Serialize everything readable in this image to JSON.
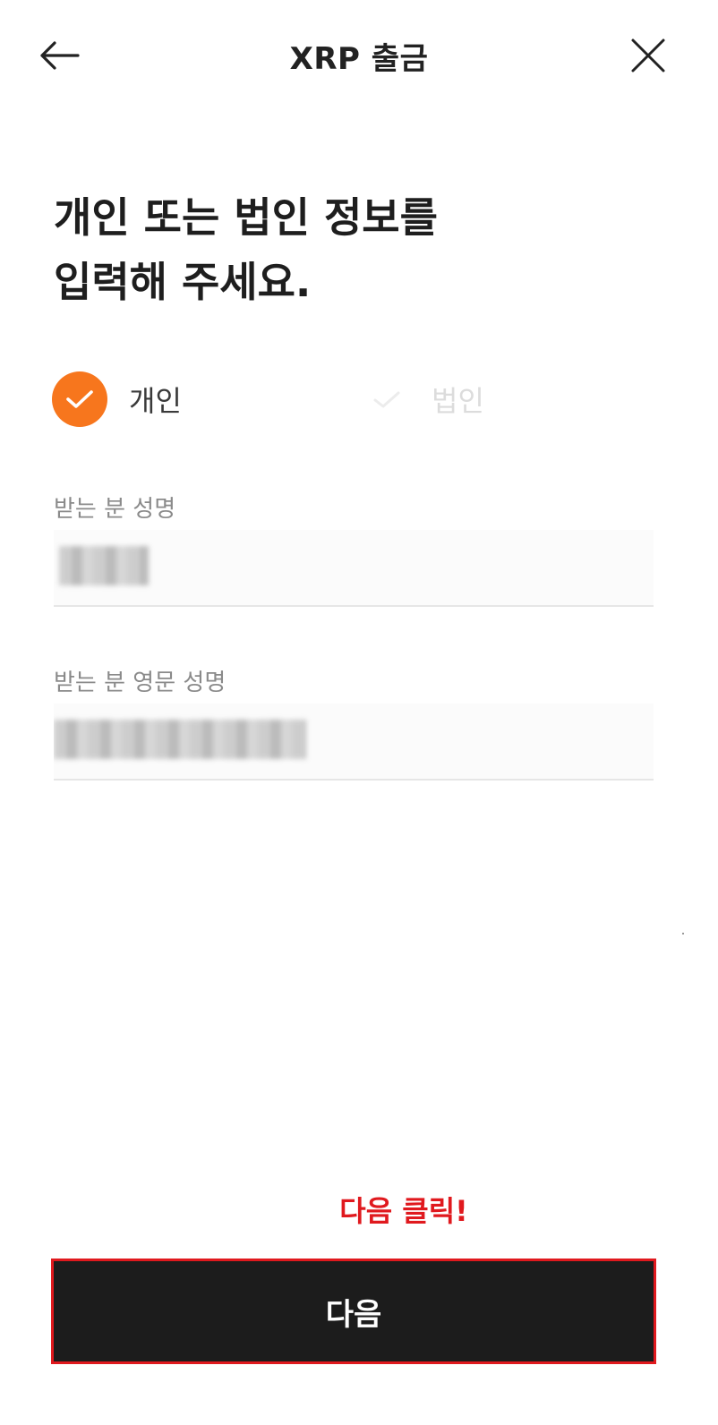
{
  "header": {
    "title": "XRP 출금",
    "back_icon": "arrow-left-icon",
    "close_icon": "close-icon"
  },
  "heading": {
    "line1": "개인 또는 법인 정보를",
    "line2": "입력해 주세요."
  },
  "type_selector": {
    "options": [
      {
        "label": "개인",
        "selected": true
      },
      {
        "label": "법인",
        "selected": false
      }
    ],
    "accent_color": "#f7761d"
  },
  "fields": [
    {
      "label": "받는 분 성명"
    },
    {
      "label": "받는 분 영문 성명"
    }
  ],
  "hint_text": "다음 클릭!",
  "next_button_label": "다음",
  "colors": {
    "hint": "#e0191e",
    "button_bg": "#1c1c1c",
    "button_border": "#e0191e"
  }
}
